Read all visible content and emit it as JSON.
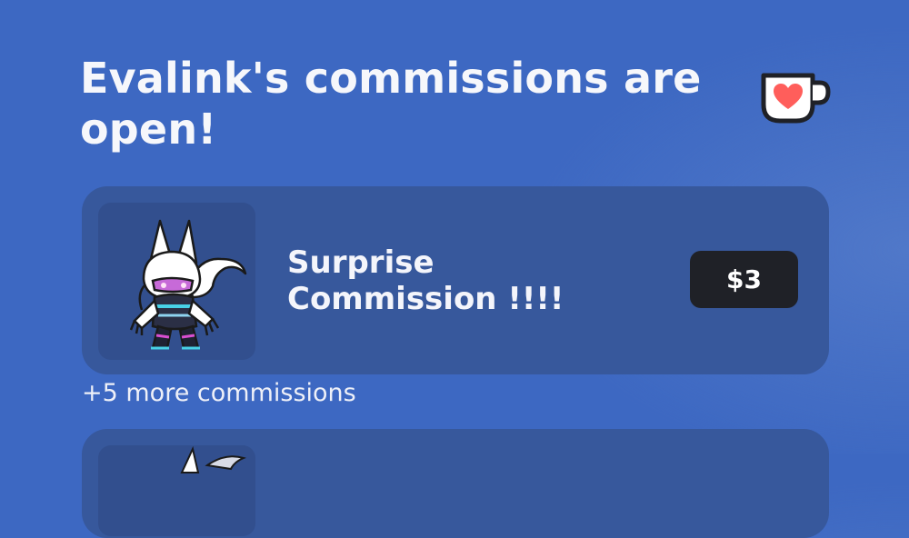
{
  "header": {
    "title": "Evalink's commissions are open!",
    "logo_icon": "kofi-cup-heart-icon"
  },
  "commissions": [
    {
      "name": "Surprise Commission !!!!",
      "price": "$3",
      "thumbnail_icon": "chibi-character-icon"
    }
  ],
  "more_link": "+5 more commissions",
  "colors": {
    "background": "#3d68c2",
    "card": "#37589c",
    "thumbnail": "#324f8e",
    "price_button": "#1f2127",
    "heart": "#ff5e5b"
  }
}
